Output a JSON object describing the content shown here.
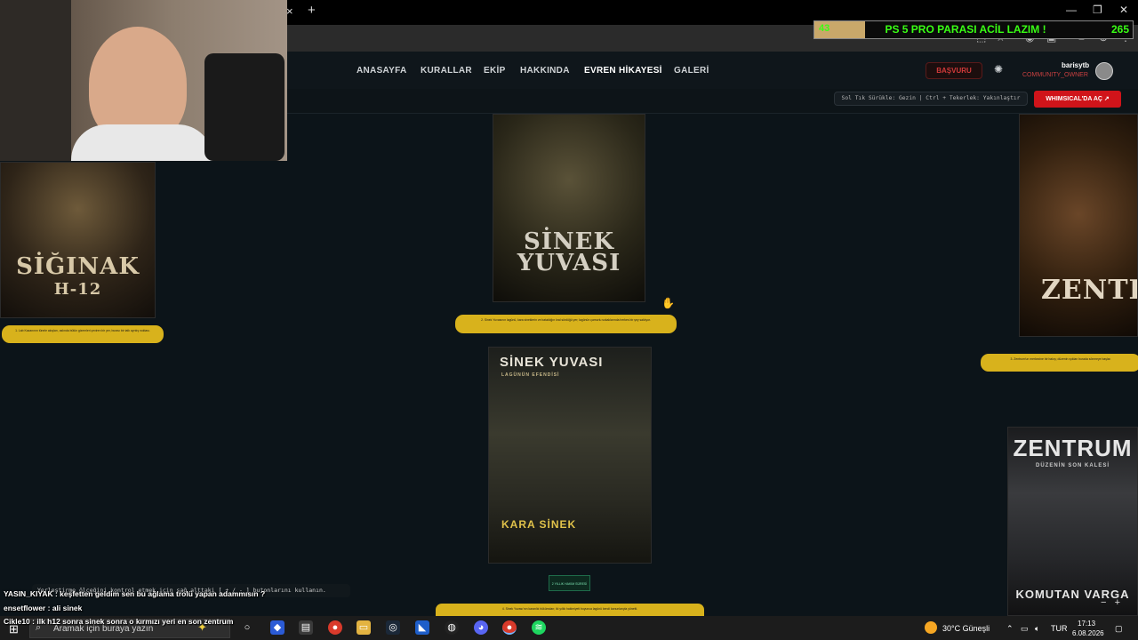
{
  "browser": {
    "tab_close_glyph": "×",
    "tab_new_glyph": "+",
    "window_controls": [
      "—",
      "❐",
      "✕"
    ]
  },
  "donation": {
    "current": "43",
    "title": "PS 5 PRO PARASI ACİL LAZIM !",
    "goal": "265",
    "progress_fraction": 0.16,
    "color": "#39ff14"
  },
  "nav": {
    "links": [
      "ANASAYFA",
      "KURALLAR",
      "EKİP",
      "HAKKINDA",
      "EVREN HİKAYESİ",
      "GALERİ"
    ],
    "active_index": 4,
    "apply_label": "BAŞVURU",
    "username": "barisytb",
    "user_role": "COMMUNITY_OWNER"
  },
  "toolbar": {
    "hint": "Sol Tık Sürükle: Gezin | Ctrl + Tekerlek: Yakınlaştır",
    "open_label": "WHIMSICAL'DA AÇ"
  },
  "canvas": {
    "posters": [
      {
        "title_line1": "SİĞINAK",
        "title_line2": "H-12"
      },
      {
        "title_line1": "SİNEK",
        "title_line2": "YUVASI"
      },
      {
        "title_line1": "ZENTRU",
        "title_line2": ""
      },
      {
        "title_line1": "SİNEK YUVASI",
        "title_line2": "LAGÜNÜN EFENDİSİ",
        "footer": "KARA SİNEK"
      },
      {
        "title_line1": "ZENTRUM",
        "title_line2": "DÜZENİN SON KALESİ",
        "footer": "KOMUTAN VARGA"
      }
    ],
    "tag_label": "2 YILLIK HAKIM SÜRESİ",
    "accent": "#d8b21c"
  },
  "help_bar": "Yerleştirme ölçeğini kontrol etmek için sağ alttaki [ + / - ] butonlarını kullanın.",
  "zoom_controls": [
    "−",
    "+"
  ],
  "chat": [
    {
      "user": "YASIN_KIYAK",
      "text": "keşfetten geldim sen bu ağlama trolü yapan adammısın ?"
    },
    {
      "user": "ensetflower",
      "text": "ali sinek"
    },
    {
      "user": "Cikle10",
      "text": "ilk h12 sonra sinek sonra o kırmızı yeri en son zentrum"
    }
  ],
  "taskbar": {
    "search_placeholder": "Aramak için buraya yazın",
    "weather": "30°C  Güneşli",
    "language": "TUR",
    "time": "17:13",
    "date": "6.08.2026"
  }
}
